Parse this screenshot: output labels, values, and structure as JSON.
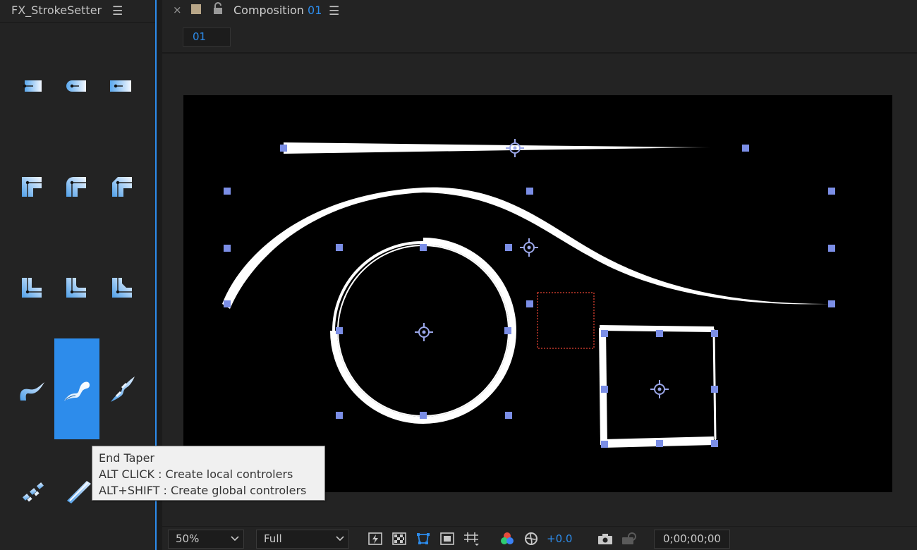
{
  "left_panel": {
    "title": "FX_StrokeSetter",
    "menu_glyph": "☰",
    "tools": [
      {
        "name": "stroke-cap-butt-tool",
        "icon": "cap-butt-icon",
        "active": false
      },
      {
        "name": "stroke-cap-round-tool",
        "icon": "cap-round-icon",
        "active": false
      },
      {
        "name": "stroke-cap-square-tool",
        "icon": "cap-square-icon",
        "active": false
      },
      {
        "name": "stroke-join-miter-tool",
        "icon": "join-miter-icon",
        "active": false
      },
      {
        "name": "stroke-join-round-tool",
        "icon": "join-round-icon",
        "active": false
      },
      {
        "name": "stroke-join-bevel-tool",
        "icon": "join-bevel-icon",
        "active": false
      },
      {
        "name": "stroke-inner-join-miter-tool",
        "icon": "inner-join-miter-icon",
        "active": false
      },
      {
        "name": "stroke-inner-join-round-tool",
        "icon": "inner-join-round-icon",
        "active": false
      },
      {
        "name": "stroke-inner-join-bevel-tool",
        "icon": "inner-join-bevel-icon",
        "active": false
      },
      {
        "name": "start-taper-tool",
        "icon": "start-taper-icon",
        "active": false
      },
      {
        "name": "end-taper-tool",
        "icon": "end-taper-icon",
        "active": true
      },
      {
        "name": "both-taper-tool",
        "icon": "wave-taper-icon",
        "active": false
      },
      {
        "name": "dashes-tool",
        "icon": "dashes-icon",
        "active": false
      },
      {
        "name": "solid-stroke-tool",
        "icon": "solid-stroke-icon",
        "active": false
      }
    ],
    "tooltip": {
      "title": "End Taper",
      "line1": "ALT CLICK : Create local controlers",
      "line2": "ALT+SHIFT : Create global controlers"
    }
  },
  "composition": {
    "close_glyph": "×",
    "tab_label": "Composition",
    "tab_number": "01",
    "menu_glyph": "☰",
    "flowchart_chip": "01",
    "swatch_color": "#b8a688",
    "accent_color": "#2d8ceb",
    "handle_color": "#7b8ee6"
  },
  "bottom_bar": {
    "zoom": "50%",
    "resolution": "Full",
    "exposure": "+0.0",
    "timecode": "0;00;00;00"
  }
}
